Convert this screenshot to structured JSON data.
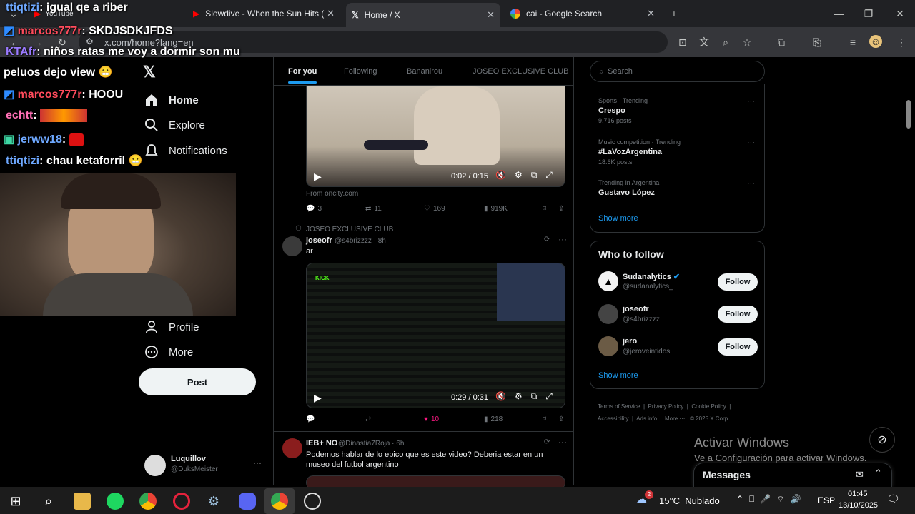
{
  "browser": {
    "tabs": [
      {
        "label": "YouTube"
      },
      {
        "label": "Slowdive - When the Sun Hits ("
      },
      {
        "label": "Home / X"
      },
      {
        "label": "cai - Google Search"
      }
    ],
    "url": "x.com/home?lang=en"
  },
  "stream_chat": [
    {
      "user": "ttiqtizi",
      "text": ": igual qe a riber",
      "color": "#6ea8ff"
    },
    {
      "user": "marcos777r",
      "text": ": SKDJSDKJFDS",
      "color": "#ff4b5c"
    },
    {
      "user": "KTAfr",
      "text": ": niños ratas me voy a dormir son mu",
      "color": "#9b7bff"
    },
    {
      "user": "",
      "text": "peluos dejo view",
      "color": "#ffffff"
    },
    {
      "user": "marcos777r",
      "text": ": HOOU",
      "color": "#ff4b5c"
    },
    {
      "user": "echtt",
      "text": ":",
      "color": "#ff6fb5"
    },
    {
      "user": "jerww18",
      "text": ":",
      "color": "#6ea8ff"
    },
    {
      "user": "ttiqtizi",
      "text": ": chau ketaforril",
      "color": "#6ea8ff"
    }
  ],
  "nav": {
    "home": "Home",
    "explore": "Explore",
    "notifications": "Notifications",
    "profile": "Profile",
    "more": "More",
    "post": "Post",
    "account_name": "Luquillov",
    "account_handle": "@DuksMeister"
  },
  "feed": {
    "tabs": [
      "For you",
      "Following",
      "Bananirou",
      "JOSEO EXCLUSIVE CLUB"
    ],
    "post1": {
      "video_time": "0:02 / 0:15",
      "source": "From oncity.com",
      "replies": "3",
      "reposts": "11",
      "likes": "169",
      "views": "919K"
    },
    "post2": {
      "community": "JOSEO EXCLUSIVE CLUB",
      "name": "joseofr",
      "handle": "@s4brizzzz · 8h",
      "text": "ar",
      "video_time": "0:29 / 0:31",
      "likes": "10",
      "views": "218"
    },
    "post3": {
      "name": "IEB+ NO",
      "handle": "@Dinastia7Roja · 6h",
      "text": "Podemos hablar de lo epico que es este video? Deberia estar en un museo del futbol argentino"
    }
  },
  "right": {
    "search_placeholder": "Search",
    "trends": [
      {
        "context": "Sports · Trending",
        "name": "Crespo",
        "posts": "9,716 posts"
      },
      {
        "context": "Music competition · Trending",
        "name": "#LaVozArgentina",
        "posts": "18.6K posts"
      },
      {
        "context": "Trending in Argentina",
        "name": "Gustavo López",
        "posts": ""
      }
    ],
    "show_more": "Show more",
    "who_to_follow": "Who to follow",
    "suggestions": [
      {
        "name": "Sudanalytics",
        "handle": "@sudanalytics_"
      },
      {
        "name": "joseofr",
        "handle": "@s4brizzzz"
      },
      {
        "name": "jero",
        "handle": "@jeroveintidos"
      }
    ],
    "follow_label": "Follow",
    "footer": [
      "Terms of Service",
      "Privacy Policy",
      "Cookie Policy",
      "Accessibility",
      "Ads info",
      "More ···",
      "© 2025 X Corp."
    ],
    "messages": "Messages"
  },
  "windows": {
    "activate_title": "Activar Windows",
    "activate_sub": "Ve a Configuración para activar Windows.",
    "weather": "15°C  Nublado",
    "lang": "ESP",
    "time": "01:45",
    "date": "13/10/2025",
    "weather_badge": "2"
  },
  "colors": {
    "accent": "#1d9bf0",
    "like": "#f91880",
    "bg": "#000000"
  }
}
